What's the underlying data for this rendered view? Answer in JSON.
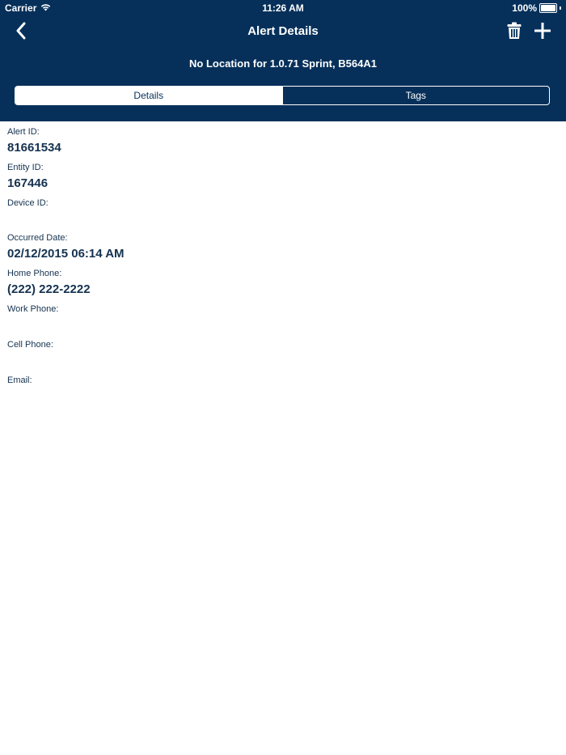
{
  "status_bar": {
    "carrier": "Carrier",
    "time": "11:26 AM",
    "battery": "100%",
    "battery_level": 1.0
  },
  "nav": {
    "title": "Alert Details",
    "back_icon": "chevron-left-icon",
    "trash_icon": "trash-icon",
    "add_icon": "plus-icon"
  },
  "subtitle": "No Location for 1.0.71 Sprint, B564A1",
  "tabs": [
    {
      "label": "Details",
      "selected": true
    },
    {
      "label": "Tags",
      "selected": false
    }
  ],
  "fields": [
    {
      "label": "Alert ID:",
      "value": "81661534"
    },
    {
      "label": "Entity ID:",
      "value": "167446"
    },
    {
      "label": "Device ID:",
      "value": ""
    },
    {
      "label": "Occurred Date:",
      "value": "02/12/2015 06:14 AM"
    },
    {
      "label": "Home Phone:",
      "value": "(222) 222-2222"
    },
    {
      "label": "Work Phone:",
      "value": ""
    },
    {
      "label": "Cell Phone:",
      "value": ""
    },
    {
      "label": "Email:",
      "value": ""
    }
  ],
  "colors": {
    "header_bg": "#06305a",
    "text": "#14324f",
    "background": "#ffffff"
  }
}
